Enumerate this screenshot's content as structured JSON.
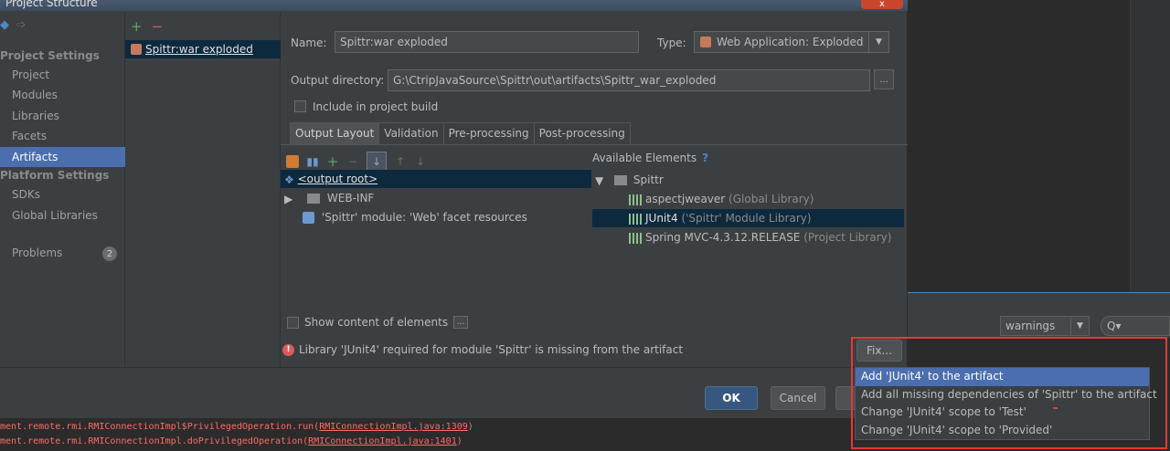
{
  "dialog": {
    "title": "Project Structure",
    "close_label": "x"
  },
  "sidebar": {
    "project_settings_heading": "Project Settings",
    "items": [
      {
        "label": "Project"
      },
      {
        "label": "Modules"
      },
      {
        "label": "Libraries"
      },
      {
        "label": "Facets"
      },
      {
        "label": "Artifacts"
      }
    ],
    "platform_settings_heading": "Platform Settings",
    "platform_items": [
      {
        "label": "SDKs"
      },
      {
        "label": "Global Libraries"
      }
    ],
    "problems_label": "Problems",
    "problems_count": "2"
  },
  "artifact_list": {
    "add_label": "+",
    "remove_label": "−",
    "selected_item": "Spittr:war exploded"
  },
  "artifact": {
    "name_label": "Name:",
    "name_value": "Spittr:war exploded",
    "type_label": "Type:",
    "type_value": "Web Application: Exploded",
    "output_dir_label": "Output directory:",
    "output_dir_value": "G:\\CtripJavaSource\\Spittr\\out\\artifacts\\Spittr_war_exploded",
    "browse_label": "...",
    "include_in_build_label": "Include in project build"
  },
  "tabs": [
    {
      "label": "Output Layout"
    },
    {
      "label": "Validation"
    },
    {
      "label": "Pre-processing"
    },
    {
      "label": "Post-processing"
    }
  ],
  "output_layout": {
    "tree": [
      {
        "label": "<output root>"
      },
      {
        "label": "WEB-INF"
      },
      {
        "label": "'Spittr' module: 'Web' facet resources"
      }
    ]
  },
  "available_elements": {
    "heading": "Available Elements",
    "help_label": "?",
    "root": "Spittr",
    "libraries": [
      {
        "name": "aspectjweaver",
        "scope": "(Global Library)"
      },
      {
        "name": "JUnit4",
        "scope": "('Spittr' Module Library)"
      },
      {
        "name": "Spring MVC-4.3.12.RELEASE",
        "scope": "(Project Library)"
      }
    ]
  },
  "show_content_label": "Show content of elements",
  "show_content_more": "...",
  "error_message": "Library 'JUnit4' required for module 'Spittr' is missing from the artifact",
  "fix_label": "Fix...",
  "fix_popup": [
    {
      "label": "Add 'JUnit4' to the artifact"
    },
    {
      "label": "Add all missing dependencies of 'Spittr' to the artifact"
    },
    {
      "label": "Change 'JUnit4' scope to 'Test'"
    },
    {
      "label": "Change 'JUnit4' scope to 'Provided'"
    }
  ],
  "buttons": {
    "ok": "OK",
    "cancel": "Cancel"
  },
  "ide": {
    "warnings_filter": "warnings",
    "search_label": "Q▾",
    "console_lines": [
      {
        "prefix": "ment.remote.rmi.RMIConnectionImpl$PrivilegedOperation.run(",
        "link": "RMIConnectionImpl.java:1309",
        "suffix": ")"
      },
      {
        "prefix": "ment.remote.rmi.RMIConnectionImpl.doPrivilegedOperation(",
        "link": "RMIConnectionImpl.java:1401",
        "suffix": ")"
      }
    ]
  },
  "colors": {
    "accent": "#4b6eaf",
    "error": "#db5c5c",
    "highlight_box": "#e53935"
  }
}
